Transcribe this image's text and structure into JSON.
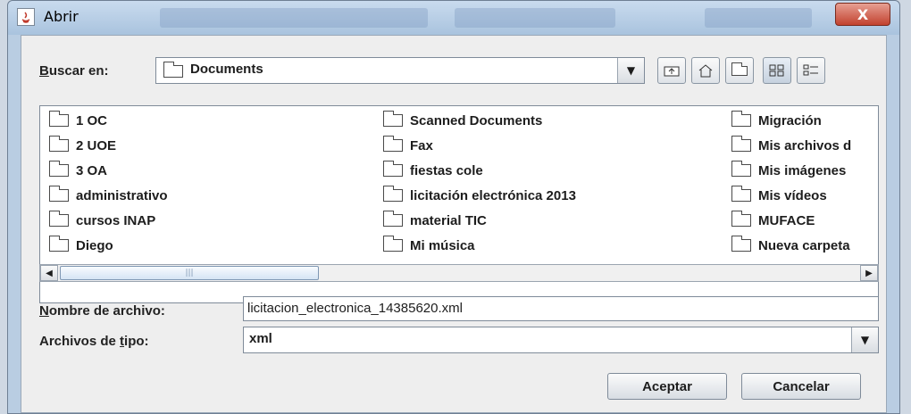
{
  "window": {
    "title": "Abrir",
    "close_symbol": "X"
  },
  "toolbar": {
    "lookin_label_u": "B",
    "lookin_label_rest": "uscar en:",
    "current_folder": "Documents",
    "buttons": [
      "up-one-level",
      "home",
      "new-folder",
      "list-view",
      "details-view"
    ]
  },
  "files": {
    "col1": [
      "1 OC",
      "2 UOE",
      "3 OA",
      "administrativo",
      "cursos INAP",
      "Diego"
    ],
    "col2": [
      "Scanned Documents",
      "Fax",
      "fiestas cole",
      "licitación electrónica 2013",
      "material TIC",
      "Mi música"
    ],
    "col3": [
      "Migración",
      "Mis archivos d",
      "Mis imágenes",
      "Mis vídeos",
      "MUFACE",
      "Nueva carpeta"
    ]
  },
  "filename": {
    "label_u": "N",
    "label_rest": "ombre de archivo:",
    "value": "licitacion_electronica_14385620.xml"
  },
  "filetype": {
    "label_pre": "Archivos de ",
    "label_u": "t",
    "label_rest": "ipo:",
    "value": "xml"
  },
  "actions": {
    "accept": "Aceptar",
    "cancel": "Cancelar"
  }
}
